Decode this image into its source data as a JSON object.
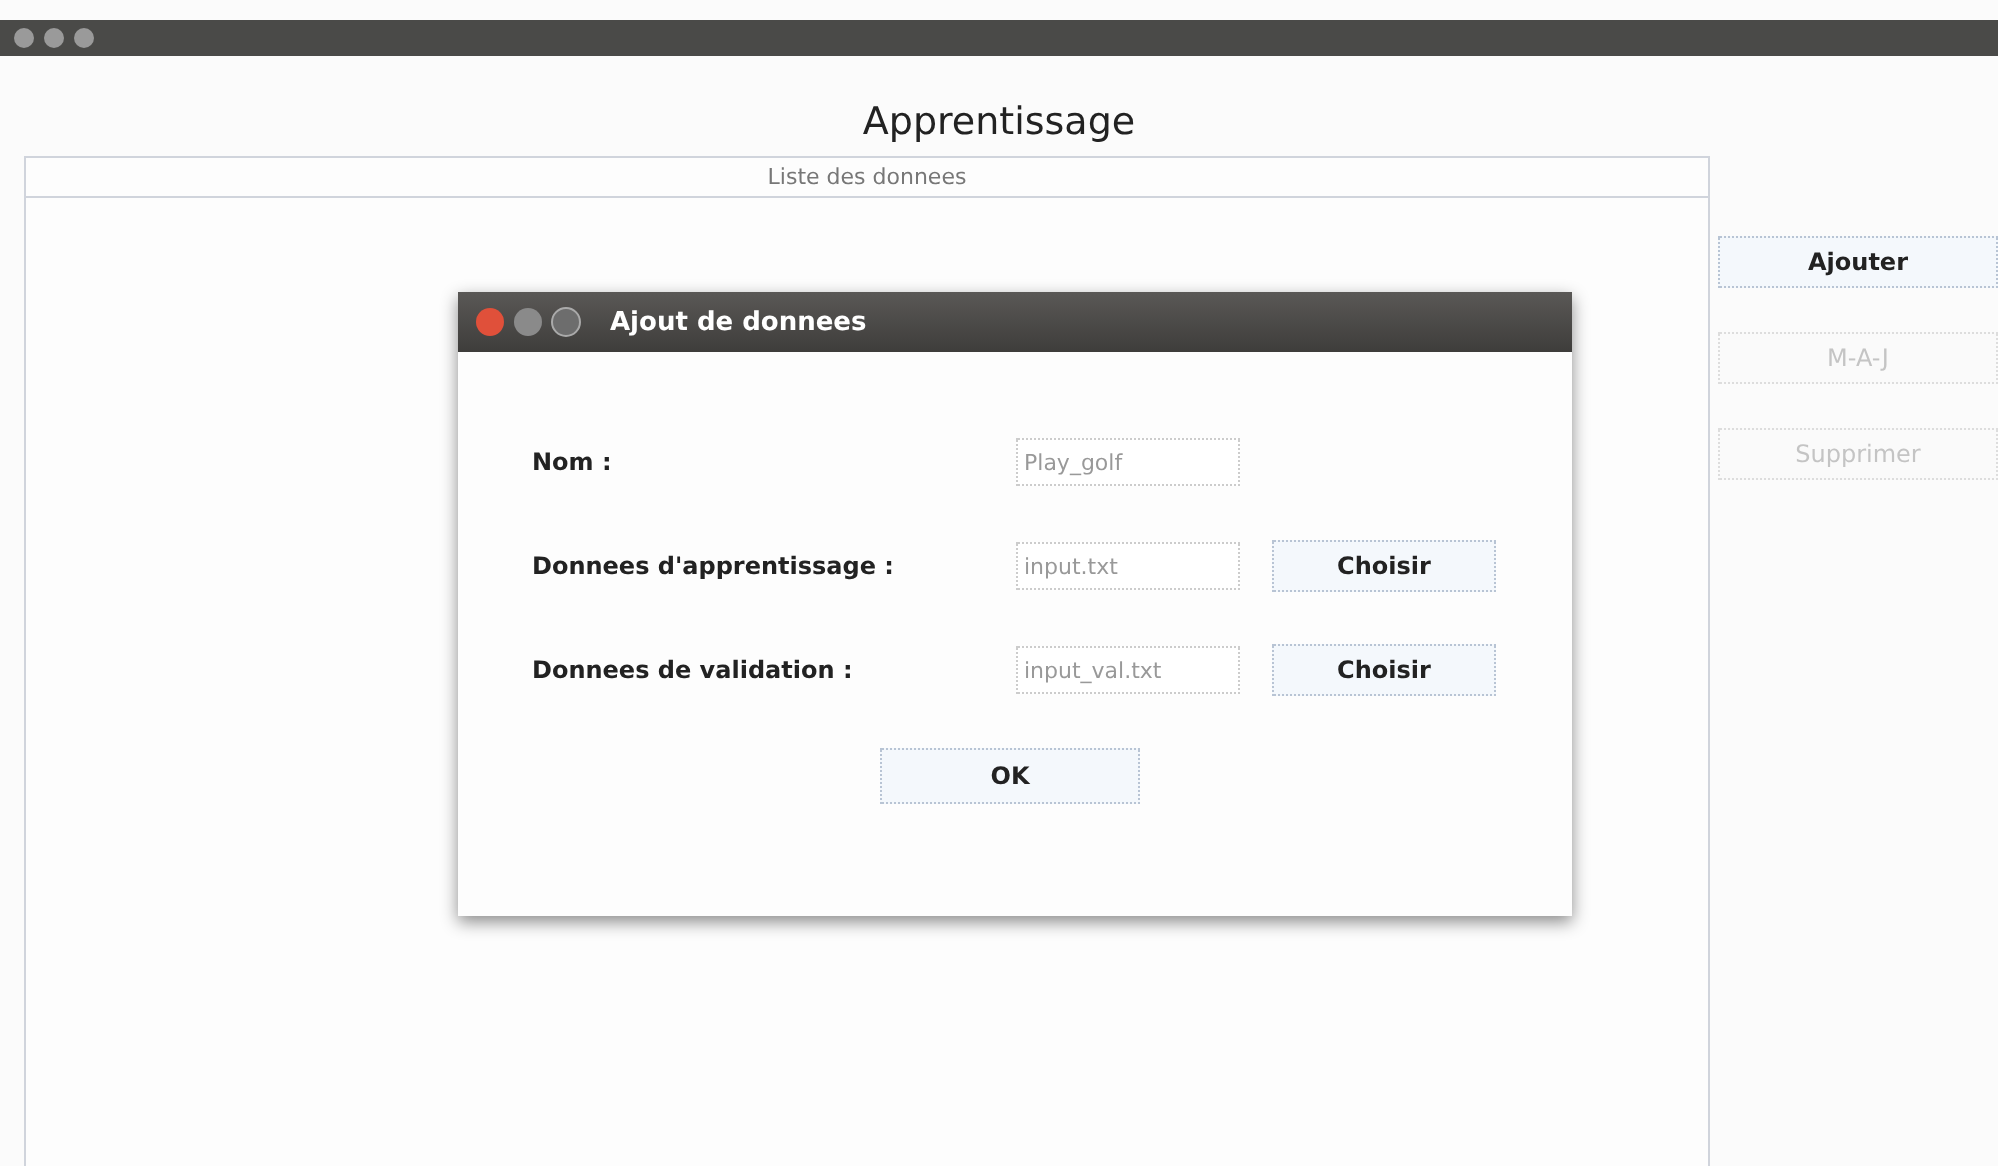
{
  "window": {
    "title": "Apprentissage"
  },
  "list": {
    "header": "Liste des donnees"
  },
  "buttons": [
    {
      "label": "Ajouter",
      "disabled": false
    },
    {
      "label": "M-A-J",
      "disabled": true
    },
    {
      "label": "Supprimer",
      "disabled": true
    }
  ],
  "dialog": {
    "title": "Ajout de donnees",
    "fields": [
      {
        "label": "Nom :",
        "value": "Play_golf"
      },
      {
        "label": "Donnees d'apprentissage :",
        "value": "input.txt",
        "button": "Choisir"
      },
      {
        "label": "Donnees de validation :",
        "value": "input_val.txt",
        "button": "Choisir"
      }
    ],
    "ok": "OK"
  }
}
